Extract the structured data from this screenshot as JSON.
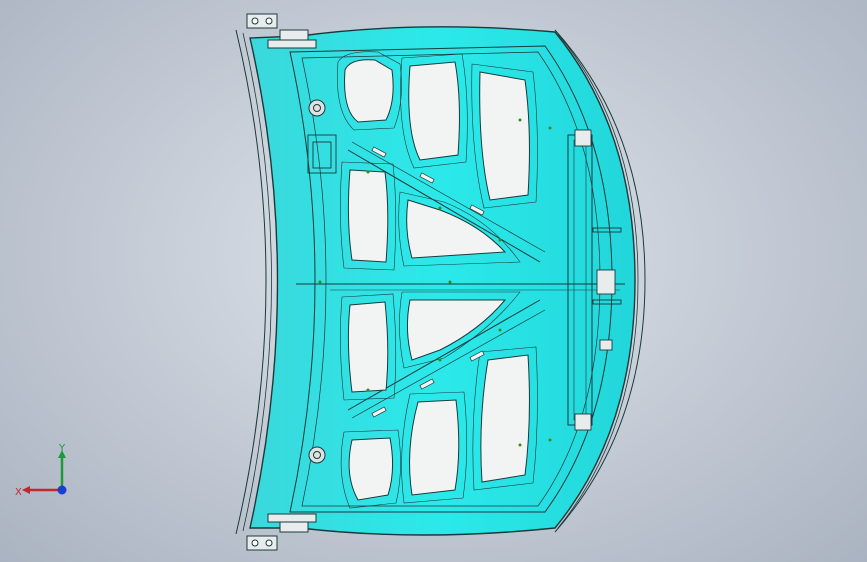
{
  "viewport": {
    "background_top": "#dfe4ea",
    "background_bottom": "#aab3c1"
  },
  "model": {
    "body_color": "#28e8e8",
    "edge_color": "#1a3a3a",
    "cutout_color": "#f2f4f4",
    "hole_color": "#dde3e3",
    "point_color": "#3a8a1a",
    "hinge_color": "#e8ecec"
  },
  "triad": {
    "x_label": "X",
    "y_label": "Y",
    "x_color": "#c0282d",
    "y_color": "#1e9a3a",
    "z_color": "#1a3fd0"
  }
}
